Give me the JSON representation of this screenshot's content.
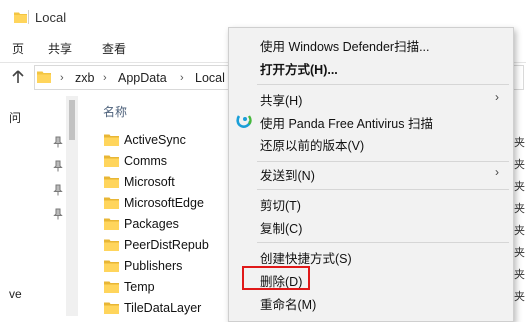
{
  "window": {
    "title": "Local"
  },
  "ribbon": {
    "tabs": [
      "页",
      "共享",
      "查看"
    ]
  },
  "address": {
    "parts": [
      "zxb",
      "AppData",
      "Local"
    ],
    "chevron": "›"
  },
  "nav": {
    "top_text": "问",
    "bottom_text": "ve",
    "pins": 4
  },
  "files": {
    "column_header": "名称",
    "items": [
      "ActiveSync",
      "Comms",
      "Microsoft",
      "MicrosoftEdge",
      "Packages",
      "PeerDistRepub",
      "Publishers",
      "Temp",
      "TileDataLayer"
    ],
    "right_col_char": "夹"
  },
  "context_menu": {
    "items": [
      {
        "label": "使用 Windows Defender扫描...",
        "bold": false
      },
      {
        "label": "打开方式(H)...",
        "bold": true
      },
      {
        "label": "共享(H)",
        "submenu": true
      },
      {
        "label": "使用 Panda Free Antivirus 扫描",
        "icon": "panda-antivirus-icon"
      },
      {
        "label": "还原以前的版本(V)"
      },
      {
        "label": "发送到(N)",
        "submenu": true
      },
      {
        "label": "剪切(T)"
      },
      {
        "label": "复制(C)"
      },
      {
        "label": "创建快捷方式(S)"
      },
      {
        "label": "删除(D)",
        "highlighted": true
      },
      {
        "label": "重命名(M)"
      }
    ],
    "submenu_arrow": "›",
    "highlight_color": "#e01919"
  }
}
